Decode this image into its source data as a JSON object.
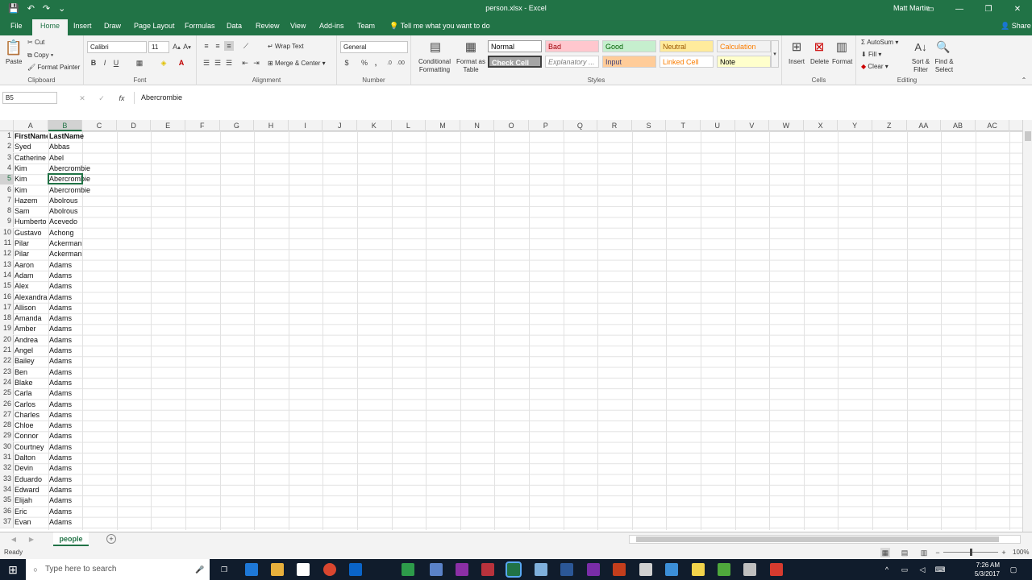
{
  "window": {
    "title": "person.xlsx - Excel",
    "user": "Matt Martin",
    "share": "Share",
    "tell_me": "Tell me what you want to do"
  },
  "tabs": [
    "File",
    "Home",
    "Insert",
    "Draw",
    "Page Layout",
    "Formulas",
    "Data",
    "Review",
    "View",
    "Add-ins",
    "Team"
  ],
  "ribbon": {
    "clipboard": {
      "label": "Clipboard",
      "paste": "Paste",
      "cut": "Cut",
      "copy": "Copy",
      "format_painter": "Format Painter"
    },
    "font": {
      "label": "Font",
      "family": "Calibri",
      "size": "11"
    },
    "alignment": {
      "label": "Alignment",
      "wrap": "Wrap Text",
      "merge": "Merge & Center"
    },
    "number": {
      "label": "Number",
      "format": "General"
    },
    "styles": {
      "label": "Styles",
      "conditional": "Conditional Formatting",
      "format_table": "Format as Table",
      "items": [
        {
          "name": "Normal",
          "bg": "#ffffff",
          "fg": "#000000"
        },
        {
          "name": "Bad",
          "bg": "#ffc7ce",
          "fg": "#9c0006"
        },
        {
          "name": "Good",
          "bg": "#c6efce",
          "fg": "#006100"
        },
        {
          "name": "Neutral",
          "bg": "#ffeb9c",
          "fg": "#9c5700"
        },
        {
          "name": "Calculation",
          "bg": "#f2f2f2",
          "fg": "#fa7d00"
        },
        {
          "name": "Check Cell",
          "bg": "#a5a5a5",
          "fg": "#ffffff"
        },
        {
          "name": "Explanatory ...",
          "bg": "#ffffff",
          "fg": "#7f7f7f"
        },
        {
          "name": "Input",
          "bg": "#ffcc99",
          "fg": "#3f3f76"
        },
        {
          "name": "Linked Cell",
          "bg": "#ffffff",
          "fg": "#fa7d00"
        },
        {
          "name": "Note",
          "bg": "#ffffcc",
          "fg": "#000000"
        }
      ]
    },
    "cells": {
      "label": "Cells",
      "insert": "Insert",
      "delete": "Delete",
      "format": "Format"
    },
    "editing": {
      "label": "Editing",
      "autosum": "AutoSum",
      "fill": "Fill",
      "clear": "Clear",
      "sort": "Sort & Filter",
      "find": "Find & Select"
    }
  },
  "formula_bar": {
    "name_box": "B5",
    "value": "Abercrombie"
  },
  "columns": [
    "A",
    "B",
    "C",
    "D",
    "E",
    "F",
    "G",
    "H",
    "I",
    "J",
    "K",
    "L",
    "M",
    "N",
    "O",
    "P",
    "Q",
    "R",
    "S",
    "T",
    "U",
    "V",
    "W",
    "X",
    "Y",
    "Z",
    "AA",
    "AB",
    "AC"
  ],
  "rows": [
    [
      "FirstName",
      "LastName"
    ],
    [
      "Syed",
      "Abbas"
    ],
    [
      "Catherine",
      "Abel"
    ],
    [
      "Kim",
      "Abercrombie"
    ],
    [
      "Kim",
      "Abercrombie"
    ],
    [
      "Kim",
      "Abercrombie"
    ],
    [
      "Hazem",
      "Abolrous"
    ],
    [
      "Sam",
      "Abolrous"
    ],
    [
      "Humberto",
      "Acevedo"
    ],
    [
      "Gustavo",
      "Achong"
    ],
    [
      "Pilar",
      "Ackerman"
    ],
    [
      "Pilar",
      "Ackerman"
    ],
    [
      "Aaron",
      "Adams"
    ],
    [
      "Adam",
      "Adams"
    ],
    [
      "Alex",
      "Adams"
    ],
    [
      "Alexandra",
      "Adams"
    ],
    [
      "Allison",
      "Adams"
    ],
    [
      "Amanda",
      "Adams"
    ],
    [
      "Amber",
      "Adams"
    ],
    [
      "Andrea",
      "Adams"
    ],
    [
      "Angel",
      "Adams"
    ],
    [
      "Bailey",
      "Adams"
    ],
    [
      "Ben",
      "Adams"
    ],
    [
      "Blake",
      "Adams"
    ],
    [
      "Carla",
      "Adams"
    ],
    [
      "Carlos",
      "Adams"
    ],
    [
      "Charles",
      "Adams"
    ],
    [
      "Chloe",
      "Adams"
    ],
    [
      "Connor",
      "Adams"
    ],
    [
      "Courtney",
      "Adams"
    ],
    [
      "Dalton",
      "Adams"
    ],
    [
      "Devin",
      "Adams"
    ],
    [
      "Eduardo",
      "Adams"
    ],
    [
      "Edward",
      "Adams"
    ],
    [
      "Elijah",
      "Adams"
    ],
    [
      "Eric",
      "Adams"
    ],
    [
      "Evan",
      "Adams"
    ]
  ],
  "sheet": {
    "name": "people"
  },
  "status": {
    "ready": "Ready",
    "zoom": "100%"
  },
  "taskbar": {
    "search": "Type here to search",
    "time": "7:26 AM",
    "date": "5/3/2017"
  }
}
